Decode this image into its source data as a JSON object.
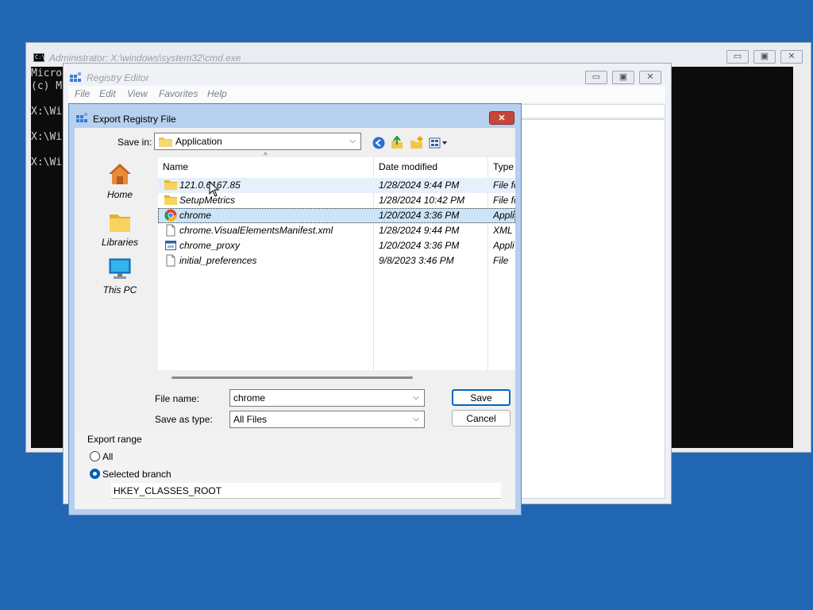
{
  "cmd_window": {
    "title": "Administrator: X:\\windows\\system32\\cmd.exe",
    "lines": [
      "Micro",
      "(c) M",
      "",
      "X:\\Wi",
      "",
      "X:\\Wi",
      "",
      "X:\\Wi"
    ]
  },
  "regedit_window": {
    "title": "Registry Editor",
    "menu": [
      "File",
      "Edit",
      "View",
      "Favorites",
      "Help"
    ]
  },
  "dialog": {
    "title": "Export Registry File",
    "save_in_label": "Save in:",
    "save_in_value": "Application",
    "places": [
      {
        "label": "Home",
        "icon": "home-icon"
      },
      {
        "label": "Libraries",
        "icon": "libraries-icon"
      },
      {
        "label": "This PC",
        "icon": "this-pc-icon"
      }
    ],
    "columns": {
      "name": "Name",
      "date": "Date modified",
      "type": "Type"
    },
    "files": [
      {
        "name": "121.0.6167.85",
        "date": "1/28/2024 9:44 PM",
        "type": "File fo",
        "icon": "folder-icon"
      },
      {
        "name": "SetupMetrics",
        "date": "1/28/2024 10:42 PM",
        "type": "File fo",
        "icon": "folder-icon"
      },
      {
        "name": "chrome",
        "date": "1/20/2024 3:36 PM",
        "type": "Appli",
        "icon": "chrome-icon"
      },
      {
        "name": "chrome.VisualElementsManifest.xml",
        "date": "1/28/2024 9:44 PM",
        "type": "XML",
        "icon": "file-icon"
      },
      {
        "name": "chrome_proxy",
        "date": "1/20/2024 3:36 PM",
        "type": "Appli",
        "icon": "app-icon"
      },
      {
        "name": "initial_preferences",
        "date": "9/8/2023 3:46 PM",
        "type": "File",
        "icon": "file-icon"
      }
    ],
    "file_name_label": "File name:",
    "file_name_value": "chrome",
    "save_type_label": "Save as type:",
    "save_type_value": "All Files",
    "save_button": "Save",
    "cancel_button": "Cancel",
    "export_range_label": "Export range",
    "radio_all": "All",
    "radio_selected": "Selected branch",
    "branch_value": "HKEY_CLASSES_ROOT"
  }
}
